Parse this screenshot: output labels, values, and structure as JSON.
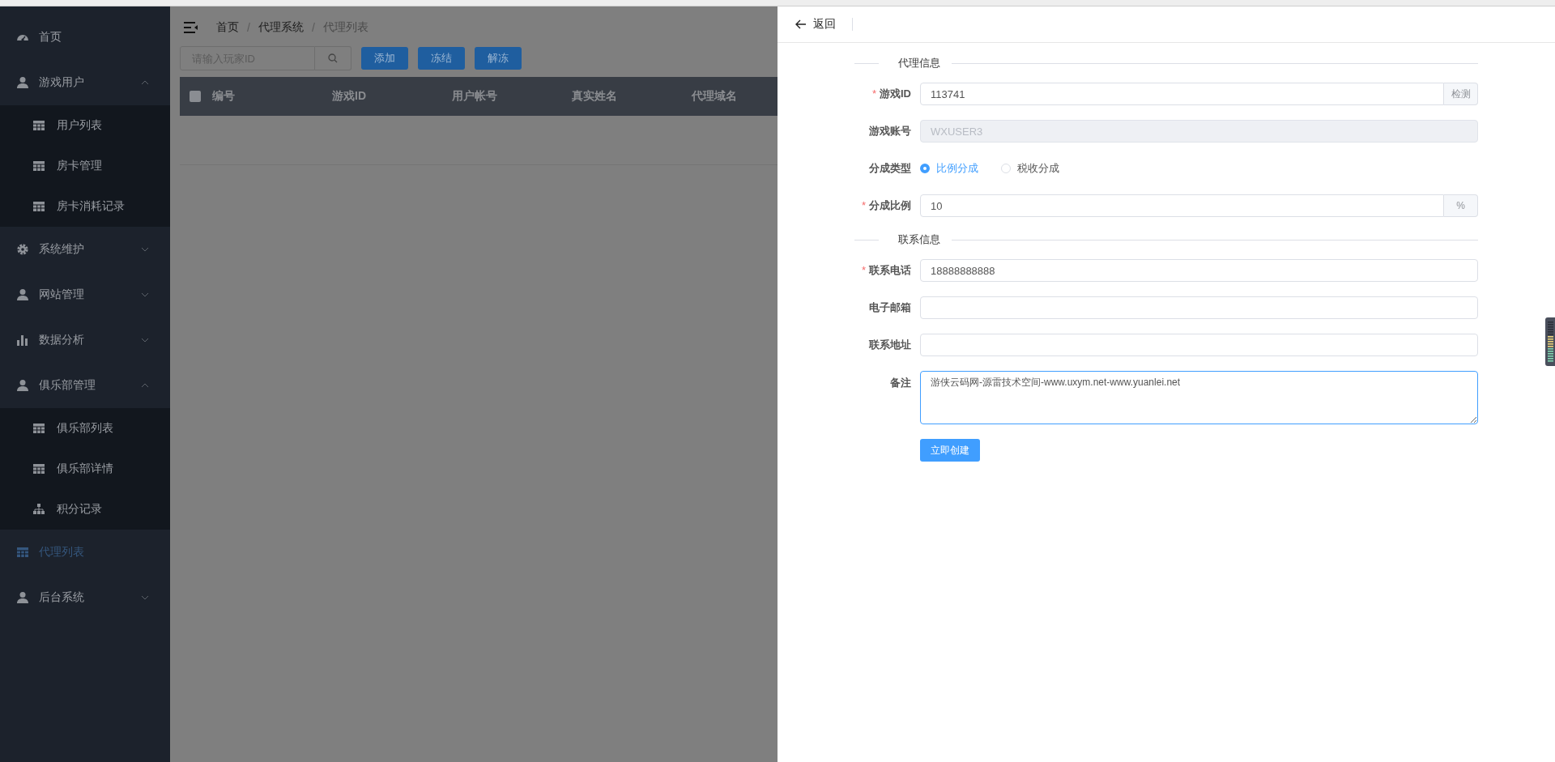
{
  "sidebar": {
    "items": [
      {
        "label": "首页",
        "kind": "link",
        "selected": false
      },
      {
        "label": "游戏用户",
        "kind": "group",
        "expanded": true,
        "selected": false,
        "children": [
          {
            "label": "用户列表",
            "selected": false
          },
          {
            "label": "房卡管理",
            "selected": false
          },
          {
            "label": "房卡消耗记录",
            "selected": false
          }
        ]
      },
      {
        "label": "系统维护",
        "kind": "group",
        "expanded": false,
        "selected": false
      },
      {
        "label": "网站管理",
        "kind": "group",
        "expanded": false,
        "selected": false
      },
      {
        "label": "数据分析",
        "kind": "group",
        "expanded": false,
        "selected": false
      },
      {
        "label": "俱乐部管理",
        "kind": "group",
        "expanded": true,
        "selected": false,
        "children": [
          {
            "label": "俱乐部列表",
            "selected": false
          },
          {
            "label": "俱乐部详情",
            "selected": false
          },
          {
            "label": "积分记录",
            "selected": false
          }
        ]
      },
      {
        "label": "代理列表",
        "kind": "link",
        "selected": true
      },
      {
        "label": "后台系统",
        "kind": "group",
        "expanded": false,
        "selected": false
      }
    ]
  },
  "breadcrumb": {
    "items": [
      {
        "label": "首页",
        "current": false
      },
      {
        "label": "代理系统",
        "current": false
      },
      {
        "label": "代理列表",
        "current": true
      }
    ],
    "separators": [
      "/",
      "/"
    ]
  },
  "toolbar": {
    "search": {
      "placeholder": "请输入玩家ID"
    },
    "buttons": [
      "添加",
      "冻结",
      "解冻"
    ]
  },
  "table": {
    "select_all": {
      "checked": false
    },
    "columns": [
      "编号",
      "游戏ID",
      "用户帐号",
      "真实姓名",
      "代理域名"
    ]
  },
  "drawer": {
    "back": "返回",
    "sections": [
      {
        "title": "代理信息",
        "fields": [
          {
            "label": "游戏ID",
            "kind": "input",
            "required_mark": "*",
            "disabled": false,
            "value": "113741",
            "append": "检测"
          },
          {
            "label": "游戏账号",
            "kind": "input",
            "disabled": true,
            "value": "WXUSER3"
          },
          {
            "label": "分成类型",
            "kind": "radio",
            "options": [
              {
                "label": "比例分成",
                "selected": true
              },
              {
                "label": "税收分成",
                "selected": false
              }
            ]
          },
          {
            "label": "分成比例",
            "kind": "input",
            "required_mark": "*",
            "disabled": false,
            "value": "10",
            "append": "%"
          }
        ]
      },
      {
        "title": "联系信息",
        "fields": [
          {
            "label": "联系电话",
            "kind": "input",
            "required_mark": "*",
            "disabled": false,
            "value": "18888888888"
          },
          {
            "label": "电子邮箱",
            "kind": "input",
            "disabled": false
          },
          {
            "label": "联系地址",
            "kind": "input",
            "disabled": false
          },
          {
            "label": "备注",
            "kind": "textarea",
            "focused": true,
            "value": "游侠云码网-源雷技术空间-www.uxym.net-www.yuanlei.net"
          }
        ]
      }
    ],
    "submit": "立即创建"
  }
}
